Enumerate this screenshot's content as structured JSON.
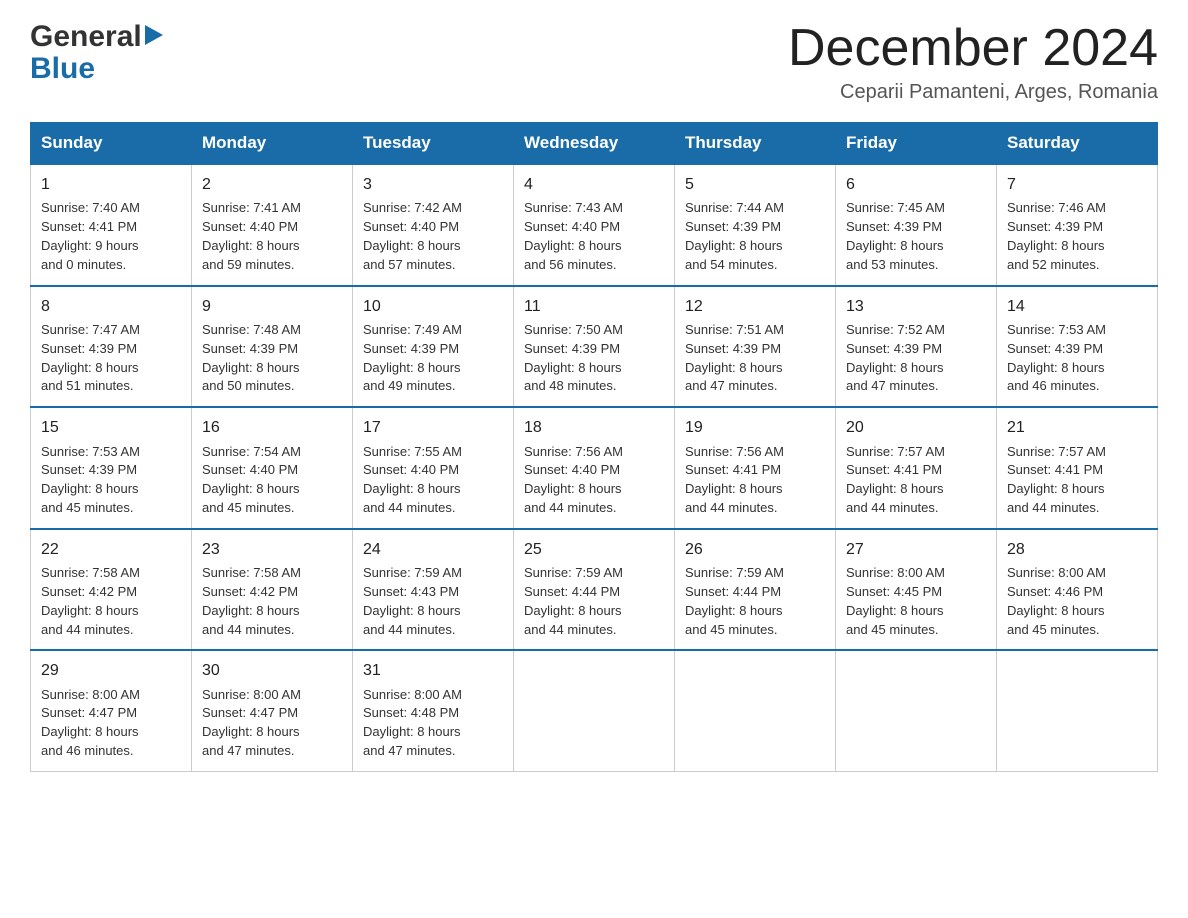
{
  "logo": {
    "general": "General",
    "blue": "Blue"
  },
  "title": "December 2024",
  "location": "Ceparii Pamanteni, Arges, Romania",
  "days_of_week": [
    "Sunday",
    "Monday",
    "Tuesday",
    "Wednesday",
    "Thursday",
    "Friday",
    "Saturday"
  ],
  "weeks": [
    [
      {
        "day": "1",
        "sunrise": "7:40 AM",
        "sunset": "4:41 PM",
        "daylight": "9 hours and 0 minutes."
      },
      {
        "day": "2",
        "sunrise": "7:41 AM",
        "sunset": "4:40 PM",
        "daylight": "8 hours and 59 minutes."
      },
      {
        "day": "3",
        "sunrise": "7:42 AM",
        "sunset": "4:40 PM",
        "daylight": "8 hours and 57 minutes."
      },
      {
        "day": "4",
        "sunrise": "7:43 AM",
        "sunset": "4:40 PM",
        "daylight": "8 hours and 56 minutes."
      },
      {
        "day": "5",
        "sunrise": "7:44 AM",
        "sunset": "4:39 PM",
        "daylight": "8 hours and 54 minutes."
      },
      {
        "day": "6",
        "sunrise": "7:45 AM",
        "sunset": "4:39 PM",
        "daylight": "8 hours and 53 minutes."
      },
      {
        "day": "7",
        "sunrise": "7:46 AM",
        "sunset": "4:39 PM",
        "daylight": "8 hours and 52 minutes."
      }
    ],
    [
      {
        "day": "8",
        "sunrise": "7:47 AM",
        "sunset": "4:39 PM",
        "daylight": "8 hours and 51 minutes."
      },
      {
        "day": "9",
        "sunrise": "7:48 AM",
        "sunset": "4:39 PM",
        "daylight": "8 hours and 50 minutes."
      },
      {
        "day": "10",
        "sunrise": "7:49 AM",
        "sunset": "4:39 PM",
        "daylight": "8 hours and 49 minutes."
      },
      {
        "day": "11",
        "sunrise": "7:50 AM",
        "sunset": "4:39 PM",
        "daylight": "8 hours and 48 minutes."
      },
      {
        "day": "12",
        "sunrise": "7:51 AM",
        "sunset": "4:39 PM",
        "daylight": "8 hours and 47 minutes."
      },
      {
        "day": "13",
        "sunrise": "7:52 AM",
        "sunset": "4:39 PM",
        "daylight": "8 hours and 47 minutes."
      },
      {
        "day": "14",
        "sunrise": "7:53 AM",
        "sunset": "4:39 PM",
        "daylight": "8 hours and 46 minutes."
      }
    ],
    [
      {
        "day": "15",
        "sunrise": "7:53 AM",
        "sunset": "4:39 PM",
        "daylight": "8 hours and 45 minutes."
      },
      {
        "day": "16",
        "sunrise": "7:54 AM",
        "sunset": "4:40 PM",
        "daylight": "8 hours and 45 minutes."
      },
      {
        "day": "17",
        "sunrise": "7:55 AM",
        "sunset": "4:40 PM",
        "daylight": "8 hours and 44 minutes."
      },
      {
        "day": "18",
        "sunrise": "7:56 AM",
        "sunset": "4:40 PM",
        "daylight": "8 hours and 44 minutes."
      },
      {
        "day": "19",
        "sunrise": "7:56 AM",
        "sunset": "4:41 PM",
        "daylight": "8 hours and 44 minutes."
      },
      {
        "day": "20",
        "sunrise": "7:57 AM",
        "sunset": "4:41 PM",
        "daylight": "8 hours and 44 minutes."
      },
      {
        "day": "21",
        "sunrise": "7:57 AM",
        "sunset": "4:41 PM",
        "daylight": "8 hours and 44 minutes."
      }
    ],
    [
      {
        "day": "22",
        "sunrise": "7:58 AM",
        "sunset": "4:42 PM",
        "daylight": "8 hours and 44 minutes."
      },
      {
        "day": "23",
        "sunrise": "7:58 AM",
        "sunset": "4:42 PM",
        "daylight": "8 hours and 44 minutes."
      },
      {
        "day": "24",
        "sunrise": "7:59 AM",
        "sunset": "4:43 PM",
        "daylight": "8 hours and 44 minutes."
      },
      {
        "day": "25",
        "sunrise": "7:59 AM",
        "sunset": "4:44 PM",
        "daylight": "8 hours and 44 minutes."
      },
      {
        "day": "26",
        "sunrise": "7:59 AM",
        "sunset": "4:44 PM",
        "daylight": "8 hours and 45 minutes."
      },
      {
        "day": "27",
        "sunrise": "8:00 AM",
        "sunset": "4:45 PM",
        "daylight": "8 hours and 45 minutes."
      },
      {
        "day": "28",
        "sunrise": "8:00 AM",
        "sunset": "4:46 PM",
        "daylight": "8 hours and 45 minutes."
      }
    ],
    [
      {
        "day": "29",
        "sunrise": "8:00 AM",
        "sunset": "4:47 PM",
        "daylight": "8 hours and 46 minutes."
      },
      {
        "day": "30",
        "sunrise": "8:00 AM",
        "sunset": "4:47 PM",
        "daylight": "8 hours and 47 minutes."
      },
      {
        "day": "31",
        "sunrise": "8:00 AM",
        "sunset": "4:48 PM",
        "daylight": "8 hours and 47 minutes."
      },
      null,
      null,
      null,
      null
    ]
  ],
  "labels": {
    "sunrise": "Sunrise:",
    "sunset": "Sunset:",
    "daylight": "Daylight:"
  }
}
